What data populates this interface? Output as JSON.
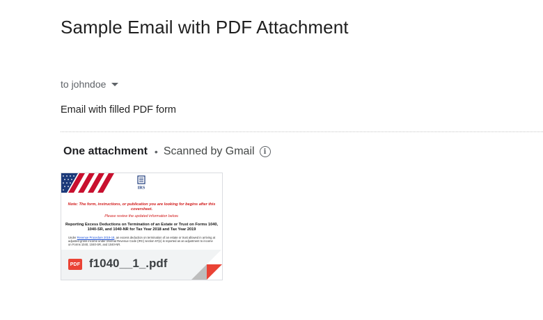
{
  "email": {
    "subject": "Sample Email with PDF Attachment",
    "recipients": "to johndoe",
    "body": "Email with filled PDF form"
  },
  "attachments": {
    "count_label": "One attachment",
    "separator": "•",
    "scan_label": "Scanned by Gmail",
    "info_icon": "info-icon",
    "file": {
      "name": "f1040__1_.pdf",
      "type_badge": "PDF",
      "preview": {
        "logo_text": "IRS",
        "notice": "Note: The form, instructions, or publication you are looking for begins after this coversheet.",
        "review": "Please review the updated information below.",
        "heading": "Reporting Excess Deductions on Termination of an Estate or Trust on Forms 1040, 1040-SR, and 1040-NR for Tax Year 2018 and Tax Year 2019",
        "body_link": "Revenue Procedure 2019-18",
        "body_prefix": "Under ",
        "body_suffix": ", an excess deduction on termination of an estate or trust allowed in arriving at adjusted gross income under Internal Revenue Code (IRC) section 67(e) is reported as an adjustment to income on Forms 1040, 1040-SR, and 1040-NR."
      }
    }
  },
  "colors": {
    "pdf_red": "#ea4335",
    "notice_red": "#d11a1a",
    "flag_blue": "#1c3a7a",
    "flag_red": "#c8102e",
    "corner_gray": "#bdbdbd"
  }
}
